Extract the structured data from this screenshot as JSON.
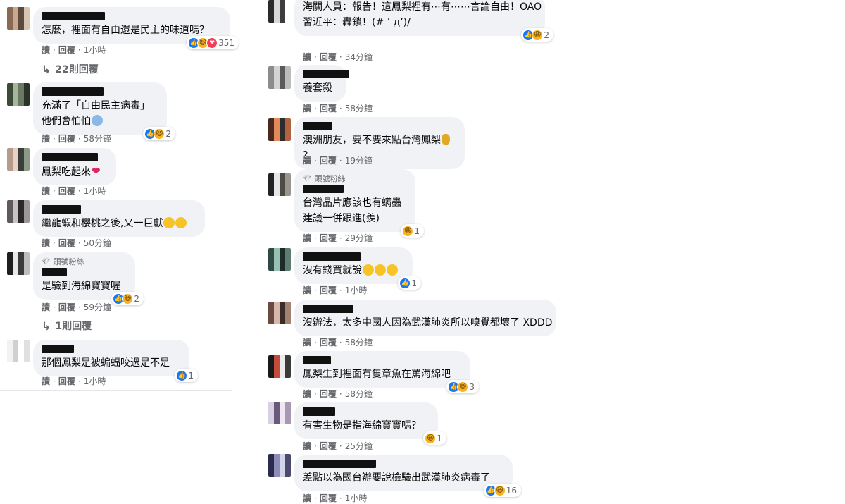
{
  "left": [
    {
      "id": "l1",
      "avatar": [
        "#8a6a55",
        "#c9a88f",
        "#5c4a3c",
        "#d8c4b2"
      ],
      "name_width": 90,
      "badge": "",
      "lines": [
        "怎麼，裡面有自由還是民主的味道嗎？"
      ],
      "emoji": "",
      "reactions": [
        "like",
        "haha",
        "love"
      ],
      "count": "351",
      "actions": {
        "read": "讀",
        "reply": "回覆",
        "time": "1小時"
      },
      "replies": "22則回覆"
    },
    {
      "id": "l2",
      "avatar": [
        "#3c4a38",
        "#a7b59a",
        "#6a7a62",
        "#2b3227"
      ],
      "name_width": 88,
      "badge": "",
      "lines": [
        "充滿了「自由民主病毒」",
        "他們會怕怕"
      ],
      "emoji": "scared",
      "reactions": [
        "like",
        "haha"
      ],
      "count": "2",
      "actions": {
        "read": "讀",
        "reply": "回覆",
        "time": "58分鐘"
      },
      "replies": ""
    },
    {
      "id": "l3",
      "avatar": [
        "#b89a8a",
        "#e7d3c6",
        "#3b3e3a",
        "#8a9a86"
      ],
      "name_width": 80,
      "badge": "",
      "lines": [
        "鳳梨吃起來"
      ],
      "emoji": "heart",
      "reactions": [],
      "count": "",
      "actions": {
        "read": "讀",
        "reply": "回覆",
        "time": "1小時"
      },
      "replies": ""
    },
    {
      "id": "l4",
      "avatar": [
        "#5e5a5c",
        "#c8c2c4",
        "#2a2829",
        "#9b969a"
      ],
      "name_width": 56,
      "badge": "",
      "lines": [
        "繼龍蝦和櫻桃之後,又一巨獻"
      ],
      "emoji": "grin2",
      "reactions": [],
      "count": "",
      "actions": {
        "read": "讀",
        "reply": "回覆",
        "time": "50分鐘"
      },
      "replies": ""
    },
    {
      "id": "l5",
      "avatar": [
        "#1e1e1e",
        "#e8e8e8",
        "#3a3a3a",
        "#bdbdbd"
      ],
      "name_width": 36,
      "badge": "頭號粉絲",
      "lines": [
        "是驗到海綿寶寶喔"
      ],
      "emoji": "",
      "reactions": [
        "like",
        "haha"
      ],
      "count": "2",
      "actions": {
        "read": "讀",
        "reply": "回覆",
        "time": "59分鐘"
      },
      "replies": "1則回覆"
    },
    {
      "id": "l6",
      "avatar": [
        "#f2f2f2",
        "#d0d0d0",
        "#ffffff",
        "#e0e0e0"
      ],
      "name_width": 46,
      "badge": "",
      "lines": [
        "那個鳳梨是被蝙蝠咬過是不是"
      ],
      "emoji": "",
      "reactions": [
        "like"
      ],
      "count": "1",
      "actions": {
        "read": "讀",
        "reply": "回覆",
        "time": "1小時"
      },
      "replies": ""
    }
  ],
  "right": [
    {
      "id": "r1",
      "avatar": [
        "#2a2a2a",
        "#d8d8d8",
        "#3d3d3d",
        "#ffffff"
      ],
      "name_width": 0,
      "badge": "",
      "lines": [
        "海關人員：報告！這鳳梨裡有⋯有⋯⋯言論自由！OAO",
        "習近平：轟鎖！(# ’ д’)/"
      ],
      "emoji": "",
      "reactions": [
        "like",
        "haha"
      ],
      "count": "2",
      "actions": {
        "read": "讀",
        "reply": "回覆",
        "time": "34分鐘"
      }
    },
    {
      "id": "r2",
      "avatar": [
        "#8c8c8c",
        "#d4d4d4",
        "#5a5a5a",
        "#bcbcbc"
      ],
      "name_width": 66,
      "badge": "",
      "lines": [
        "養套殺"
      ],
      "emoji": "",
      "reactions": [],
      "count": "",
      "actions": {
        "read": "讀",
        "reply": "回覆",
        "time": "58分鐘"
      }
    },
    {
      "id": "r3",
      "avatar": [
        "#4a2a1e",
        "#e38a5a",
        "#2d2d2d",
        "#b2623c"
      ],
      "name_width": 42,
      "badge": "",
      "lines": [
        "澳洲朋友，要不要來點台灣鳳梨",
        "？"
      ],
      "emoji": "pineapple",
      "reactions": [],
      "count": "",
      "actions": {
        "read": "讀",
        "reply": "回覆",
        "time": "19分鐘"
      }
    },
    {
      "id": "r4",
      "avatar": [
        "#222222",
        "#e6e6e6",
        "#4e4a44",
        "#9a968e"
      ],
      "name_width": 58,
      "badge": "頭號粉絲",
      "lines": [
        "台灣晶片應該也有螨蟲",
        "建議一併跟進(羨)"
      ],
      "emoji": "",
      "reactions": [
        "haha"
      ],
      "count": "1",
      "actions": {
        "read": "讀",
        "reply": "回覆",
        "time": "29分鐘"
      }
    },
    {
      "id": "r5",
      "avatar": [
        "#2f4a44",
        "#98c0b2",
        "#1d2c28",
        "#5e7c72"
      ],
      "name_width": 82,
      "badge": "",
      "lines": [
        "沒有錢買就說"
      ],
      "emoji": "sad3",
      "reactions": [
        "like"
      ],
      "count": "1",
      "actions": {
        "read": "讀",
        "reply": "回覆",
        "time": "1小時"
      }
    },
    {
      "id": "r6",
      "avatar": [
        "#6a4a40",
        "#d8b8aa",
        "#3a2c28",
        "#a48272"
      ],
      "name_width": 72,
      "badge": "",
      "lines": [
        "沒辦法，太多中國人因為武漢肺炎所以嗅覺都壞了 XDDD"
      ],
      "emoji": "",
      "reactions": [],
      "count": "",
      "actions": {
        "read": "讀",
        "reply": "回覆",
        "time": "58分鐘"
      }
    },
    {
      "id": "r7",
      "avatar": [
        "#1a1a1a",
        "#c44a3a",
        "#ececec",
        "#3a3a3a"
      ],
      "name_width": 40,
      "badge": "",
      "lines": [
        "鳳梨生到裡面有隻章魚在罵海綿吧"
      ],
      "emoji": "",
      "reactions": [
        "like",
        "haha"
      ],
      "count": "3",
      "actions": {
        "read": "讀",
        "reply": "回覆",
        "time": "58分鐘"
      }
    },
    {
      "id": "r8",
      "avatar": [
        "#d8d0e4",
        "#6a5a7a",
        "#efe8f2",
        "#a898b4"
      ],
      "name_width": 46,
      "badge": "",
      "lines": [
        "有害生物是指海綿寶寶嗎？"
      ],
      "emoji": "",
      "reactions": [
        "haha"
      ],
      "count": "1",
      "actions": {
        "read": "讀",
        "reply": "回覆",
        "time": "25分鐘"
      }
    },
    {
      "id": "r9",
      "avatar": [
        "#2a2a4a",
        "#8c8cb8",
        "#d4d4e8",
        "#4a4a6e"
      ],
      "name_width": 104,
      "badge": "",
      "lines": [
        "差點以為國台辦要說檢驗出武漢肺炎病毒了"
      ],
      "emoji": "",
      "reactions": [
        "like",
        "haha"
      ],
      "count": "16",
      "actions": {
        "read": "讀",
        "reply": "回覆",
        "time": "1小時"
      }
    }
  ]
}
